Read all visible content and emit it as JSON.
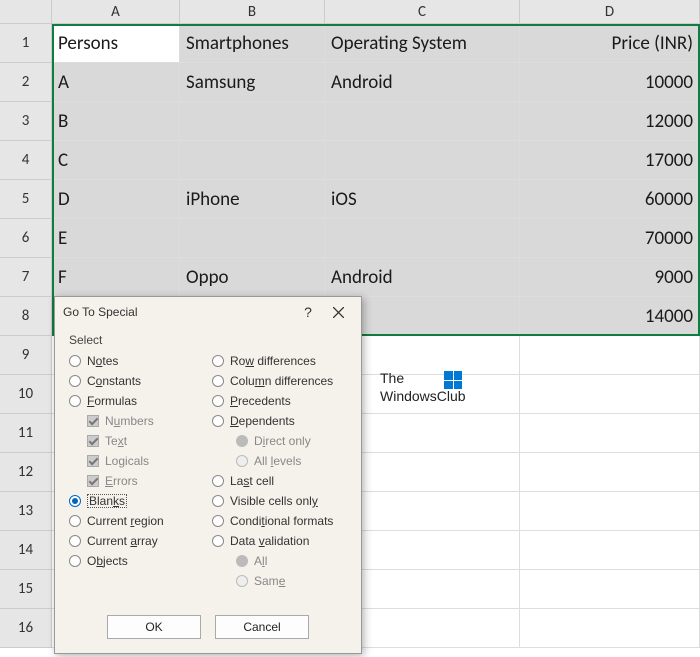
{
  "columns": [
    "A",
    "B",
    "C",
    "D"
  ],
  "rows": [
    "1",
    "2",
    "3",
    "4",
    "5",
    "6",
    "7",
    "8",
    "9",
    "10",
    "11",
    "12",
    "13",
    "14",
    "15",
    "16"
  ],
  "data": {
    "headers": {
      "A": "Persons",
      "B": "Smartphones",
      "C": "Operating System",
      "D": "Price (INR)"
    },
    "r2": {
      "A": "A",
      "B": "Samsung",
      "C": "Android",
      "D": "10000"
    },
    "r3": {
      "A": "B",
      "B": "",
      "C": "",
      "D": "12000"
    },
    "r4": {
      "A": "C",
      "B": "",
      "C": "",
      "D": "17000"
    },
    "r5": {
      "A": "D",
      "B": "iPhone",
      "C": "iOS",
      "D": "60000"
    },
    "r6": {
      "A": "E",
      "B": "",
      "C": "",
      "D": "70000"
    },
    "r7": {
      "A": "F",
      "B": "Oppo",
      "C": "Android",
      "D": "9000"
    },
    "r8": {
      "A": "",
      "B": "",
      "C": "",
      "D": "14000"
    }
  },
  "dialog": {
    "title": "Go To Special",
    "help": "?",
    "section": "Select",
    "options": {
      "notes_pre": "N",
      "notes_uc": "o",
      "notes_post": "tes",
      "constants_pre": "C",
      "constants_uc": "o",
      "constants_post": "nstants",
      "formulas_uc": "F",
      "formulas_post": "ormulas",
      "numbers_pre": "N",
      "numbers_uc": "u",
      "numbers_post": "mbers",
      "text_pre": "Te",
      "text_uc": "x",
      "text_post": "t",
      "logicals_pre": "Lo",
      "logicals_uc": "g",
      "logicals_post": "icals",
      "errors_uc": "E",
      "errors_post": "rrors",
      "blanks_pre": "Blan",
      "blanks_uc": "k",
      "blanks_post": "s",
      "current_region_pre": "Current ",
      "current_region_uc": "r",
      "current_region_post": "egion",
      "current_array_pre": "Current ",
      "current_array_uc": "a",
      "current_array_post": "rray",
      "objects_pre": "O",
      "objects_uc": "b",
      "objects_post": "jects",
      "row_diff_pre": "Ro",
      "row_diff_uc": "w",
      "row_diff_post": " differences",
      "col_diff_pre": "Colu",
      "col_diff_uc": "m",
      "col_diff_post": "n differences",
      "precedents_uc": "P",
      "precedents_post": "recedents",
      "dependents_uc": "D",
      "dependents_post": "ependents",
      "direct_only_pre": "D",
      "direct_only_uc": "i",
      "direct_only_post": "rect only",
      "all_levels_pre": "All ",
      "all_levels_uc": "l",
      "all_levels_post": "evels",
      "last_cell_pre": "La",
      "last_cell_uc": "s",
      "last_cell_post": "t cell",
      "visible_pre": "Visible cells onl",
      "visible_uc": "y",
      "cond_pre": "Condi",
      "cond_uc": "t",
      "cond_post": "ional formats",
      "data_val_pre": "Data ",
      "data_val_uc": "v",
      "data_val_post": "alidation",
      "all_pre": "A",
      "all_uc": "l",
      "all_post": "l",
      "same_pre": "Sam",
      "same_uc": "e"
    },
    "buttons": {
      "ok": "OK",
      "cancel": "Cancel"
    }
  },
  "watermark": {
    "line1": "The",
    "line2": "WindowsClub"
  }
}
